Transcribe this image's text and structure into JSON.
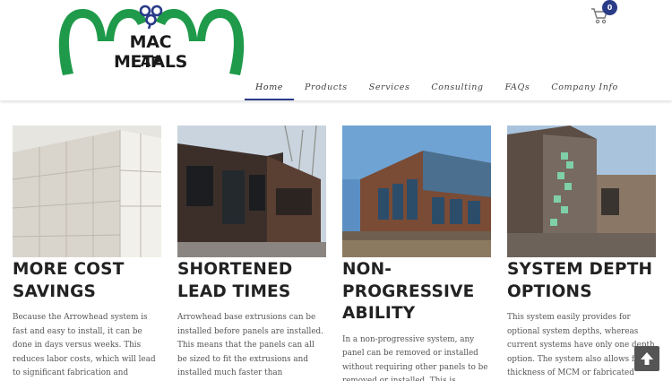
{
  "logo": {
    "line1": "MAC METALS",
    "line2": "AP"
  },
  "cart": {
    "count": "0"
  },
  "nav": {
    "items": [
      "Home",
      "Products",
      "Services",
      "Consulting",
      "FAQs",
      "Company Info"
    ]
  },
  "cards": [
    {
      "title": "MORE COST SAVINGS",
      "text": "Because the Arrowhead system is fast and easy to install, it can be done in days versus weeks. This reduces labor costs, which will lead to significant fabrication and installation cost"
    },
    {
      "title": "SHORTENED LEAD TIMES",
      "text": "Arrowhead base extrusions can be installed before panels are installed. This means that the panels can all be sized to fit the extrusions and installed much faster than"
    },
    {
      "title": "NON-PROGRESSIVE ABILITY",
      "text": "In a non-progressive system, any panel can be removed or installed without requiring other panels to be removed or installed. This is"
    },
    {
      "title": "SYSTEM DEPTH OPTIONS",
      "text": "This system easily provides for optional system depths, whereas current systems have only one depth option. The system also allows for thickness of MCM or fabricated sheet"
    }
  ],
  "colors": {
    "logo_green": "#1f9a4a",
    "accent": "#2a3b87"
  },
  "icons": {
    "cart": "shopping-cart-icon",
    "scroll": "arrow-up-icon",
    "clover": "shamrock-icon"
  }
}
